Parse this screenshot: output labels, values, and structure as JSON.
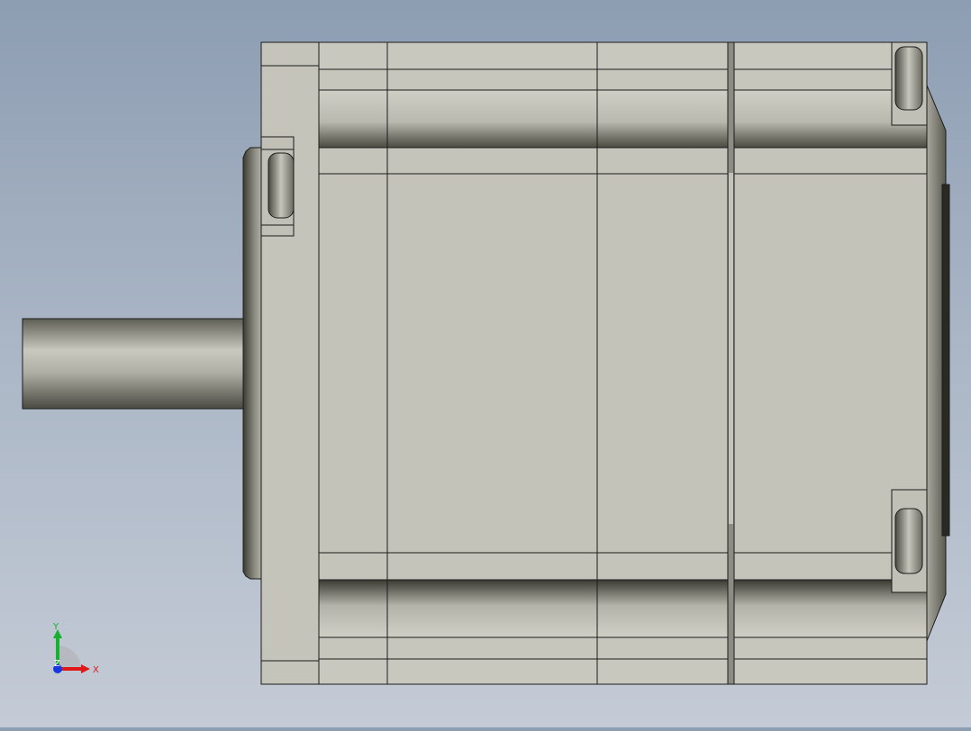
{
  "model": {
    "description_hidden": "",
    "body_color": "#c3c3b9",
    "shadow_color": "#3b3b33",
    "edge_color": "#1c1c1c"
  },
  "triad": {
    "x_label": "X",
    "y_label": "Y",
    "z_label": "Z",
    "x_color": "#e01818",
    "y_color": "#18b030",
    "z_color": "#1838e0"
  }
}
